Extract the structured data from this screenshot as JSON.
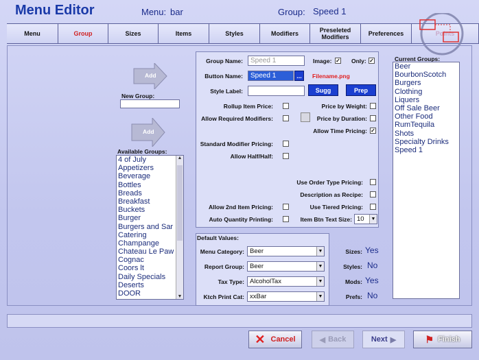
{
  "header": {
    "title": "Menu Editor",
    "menu_label": "Menu:",
    "menu_value": "bar",
    "group_label": "Group:",
    "group_value": "Speed 1"
  },
  "tabs": [
    "Menu",
    "Group",
    "Sizes",
    "Items",
    "Styles",
    "Modifiers",
    "Preseleted Modifiers",
    "Preferences",
    "Points"
  ],
  "left": {
    "add_label": "Add",
    "new_group_label": "New Group:",
    "new_group_value": "",
    "add2_label": "Add",
    "available_label": "Available Groups:",
    "available": [
      "4 of July",
      "Appetizers",
      "Beverage",
      "Bottles",
      "Breads",
      "Breakfast",
      "Buckets",
      "Burger",
      "Burgers and Sar",
      "Catering",
      "Champange",
      "Chateau Le Paw",
      "Cognac",
      "Coors lt",
      "Daily Specials",
      "Deserts",
      "DOOR"
    ]
  },
  "form": {
    "group_name_label": "Group Name:",
    "group_name_value": "Speed 1",
    "image_label": "Image:",
    "only_label": "Only:",
    "button_name_label": "Button Name:",
    "button_name_value": "Speed 1",
    "dots": "...",
    "filename": "Filename.png",
    "style_label": "Style Label:",
    "sugg": "Sugg",
    "prep": "Prep",
    "rollup": "Rollup Item Price:",
    "price_by_weight": "Price by Weight:",
    "allow_req_mod": "Allow Required Modifiers:",
    "price_by_duration": "Price by Duration:",
    "allow_time": "Allow Time Pricing:",
    "check": "✓",
    "std_mod": "Standard Modifier Pricing:",
    "allow_half": "Allow Half/Half:",
    "use_order_type": "Use Order Type Pricing:",
    "desc_recipe": "Description as Recipe:",
    "allow_2nd": "Allow 2nd Item Pricing:",
    "use_tiered": "Use Tiered Pricing:",
    "auto_qty": "Auto Quantity Printing:",
    "btn_text_size": "Item Btn Text Size:",
    "btn_text_size_value": "10"
  },
  "defaults": {
    "title": "Default Values:",
    "menu_category_label": "Menu Category:",
    "menu_category": "Beer",
    "report_group_label": "Report Group:",
    "report_group": "Beer",
    "tax_type_label": "Tax Type:",
    "tax_type": "AlcoholTax",
    "kitchen_label": "Ktch Print Cat:",
    "kitchen": "xxBar",
    "sizes_label": "Sizes:",
    "sizes": "Yes",
    "styles_label": "Styles:",
    "styles": "No",
    "mods_label": "Mods:",
    "mods": "Yes",
    "prefs_label": "Prefs:",
    "prefs": "No"
  },
  "current": {
    "label": "Current Groups:",
    "items": [
      "Beer",
      "BourbonScotch",
      "Burgers",
      "Clothing",
      "Liquers",
      "Off Sale Beer",
      "Other Food",
      "RumTequila",
      "Shots",
      "Specialty Drinks",
      "Speed 1"
    ]
  },
  "footer": {
    "cancel": "Cancel",
    "back": "Back",
    "next": "Next",
    "finish": "Finish"
  },
  "colors": {
    "accent": "#1a3aa8",
    "bg": "#c7cbf0",
    "button_blue": "#1b3fd0",
    "cancel_x": "#e02020"
  }
}
